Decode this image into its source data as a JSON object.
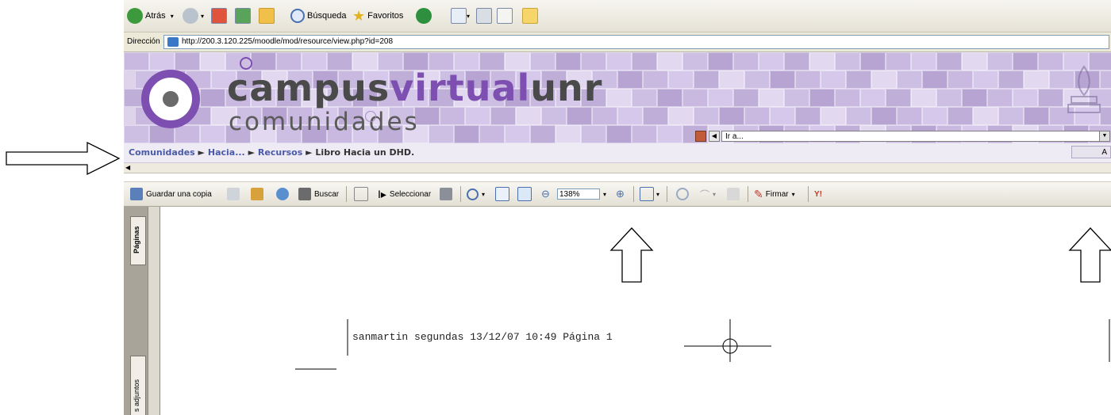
{
  "ie_toolbar": {
    "back_label": "Atrás",
    "search_label": "Búsqueda",
    "favorites_label": "Favoritos"
  },
  "address_bar": {
    "label": "Dirección",
    "url": "http://200.3.120.225/moodle/mod/resource/view.php?id=208"
  },
  "banner": {
    "logo_part1": "campus",
    "logo_part2": "virtual",
    "logo_part3": "unr",
    "logo_sub": "comunidades",
    "jump_placeholder": "Ir a..."
  },
  "breadcrumb": {
    "items": [
      "Comunidades",
      "Hacia...",
      "Recursos"
    ],
    "current": "Libro Hacia un DHD.",
    "separator": "►",
    "right_button": "A"
  },
  "pdf_toolbar": {
    "save_copy": "Guardar una copia",
    "search": "Buscar",
    "select": "Seleccionar",
    "zoom": "138%",
    "sign": "Firmar"
  },
  "pdf_sidebar": {
    "pages_tab": "Páginas",
    "attachments_tab": "s adjuntos"
  },
  "pdf_page": {
    "header_line": "sanmartin segundas  13/12/07  10:49  Página 1"
  },
  "colors": {
    "brand_purple": "#7c4fb0",
    "link_blue": "#4a5aa6"
  }
}
